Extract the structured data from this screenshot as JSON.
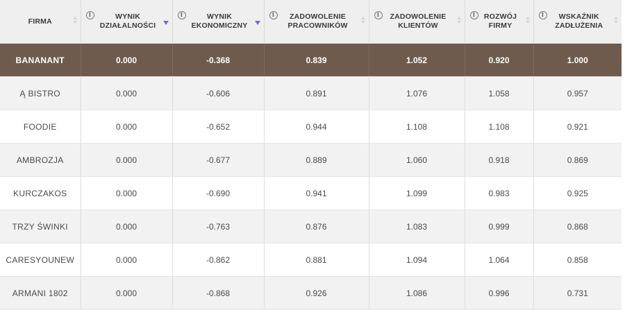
{
  "table": {
    "columns": [
      {
        "label": "FIRMA",
        "info": false,
        "sort": "both"
      },
      {
        "label": "WYNIK DZIAŁALNOŚCI",
        "info": true,
        "sort": "desc-active"
      },
      {
        "label": "WYNIK EKONOMICZNY",
        "info": true,
        "sort": "desc-active"
      },
      {
        "label": "ZADOWOLENIE PRACOWNIKÓW",
        "info": true,
        "sort": "both"
      },
      {
        "label": "ZADOWOLENIE KLIENTÓW",
        "info": true,
        "sort": "both"
      },
      {
        "label": "ROZWÓJ FIRMY",
        "info": true,
        "sort": "both"
      },
      {
        "label": "WSKAŹNIK ZADŁUŻENIA",
        "info": true,
        "sort": "both"
      }
    ],
    "info_glyph": "i",
    "highlight_color": "#6e5b4d",
    "sort_active_color": "#7b68c8",
    "rows": [
      {
        "firm": "BANANANT",
        "wynik_dzialalnosci": "0.000",
        "wynik_ekonomiczny": "-0.368",
        "zadowolenie_pracownikow": "0.839",
        "zadowolenie_klientow": "1.052",
        "rozwoj_firmy": "0.920",
        "wskaznik_zadluzenia": "1.000",
        "highlighted": true
      },
      {
        "firm": "Ą BISTRO",
        "wynik_dzialalnosci": "0.000",
        "wynik_ekonomiczny": "-0.606",
        "zadowolenie_pracownikow": "0.891",
        "zadowolenie_klientow": "1.076",
        "rozwoj_firmy": "1.058",
        "wskaznik_zadluzenia": "0.957"
      },
      {
        "firm": "FOODIE",
        "wynik_dzialalnosci": "0.000",
        "wynik_ekonomiczny": "-0.652",
        "zadowolenie_pracownikow": "0.944",
        "zadowolenie_klientow": "1.108",
        "rozwoj_firmy": "1.108",
        "wskaznik_zadluzenia": "0.921"
      },
      {
        "firm": "AMBROZJA",
        "wynik_dzialalnosci": "0.000",
        "wynik_ekonomiczny": "-0.677",
        "zadowolenie_pracownikow": "0.889",
        "zadowolenie_klientow": "1.060",
        "rozwoj_firmy": "0.918",
        "wskaznik_zadluzenia": "0.869"
      },
      {
        "firm": "KURCZAKOS",
        "wynik_dzialalnosci": "0.000",
        "wynik_ekonomiczny": "-0.690",
        "zadowolenie_pracownikow": "0.941",
        "zadowolenie_klientow": "1.099",
        "rozwoj_firmy": "0.983",
        "wskaznik_zadluzenia": "0.925"
      },
      {
        "firm": "TRZY ŚWINKI",
        "wynik_dzialalnosci": "0.000",
        "wynik_ekonomiczny": "-0.763",
        "zadowolenie_pracownikow": "0.876",
        "zadowolenie_klientow": "1.083",
        "rozwoj_firmy": "0.999",
        "wskaznik_zadluzenia": "0.868"
      },
      {
        "firm": "CARESYOUNEW",
        "wynik_dzialalnosci": "0.000",
        "wynik_ekonomiczny": "-0.862",
        "zadowolenie_pracownikow": "0.881",
        "zadowolenie_klientow": "1.094",
        "rozwoj_firmy": "1.064",
        "wskaznik_zadluzenia": "0.858"
      },
      {
        "firm": "ARMANI 1802",
        "wynik_dzialalnosci": "0.000",
        "wynik_ekonomiczny": "-0.868",
        "zadowolenie_pracownikow": "0.926",
        "zadowolenie_klientow": "1.086",
        "rozwoj_firmy": "0.996",
        "wskaznik_zadluzenia": "0.731"
      }
    ]
  }
}
